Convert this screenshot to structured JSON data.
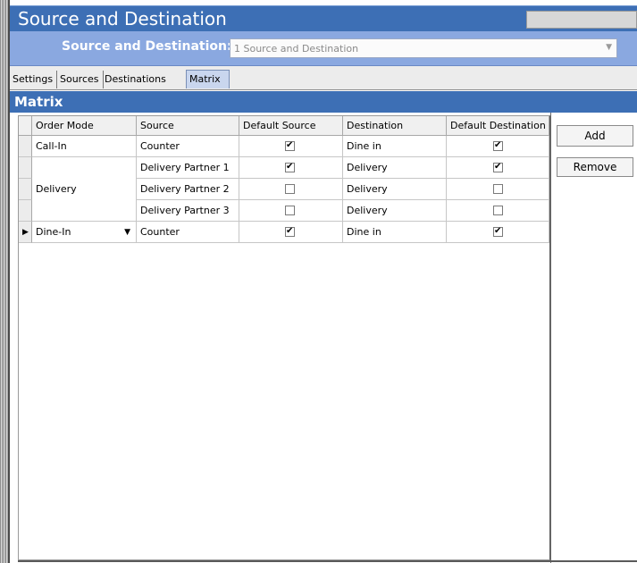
{
  "window": {
    "title": "Source and Destination"
  },
  "selector": {
    "label": "Source and Destination:",
    "value": "1 Source and Destination"
  },
  "tabs": [
    {
      "label": "Settings"
    },
    {
      "label": "Sources"
    },
    {
      "label": "Destinations"
    },
    {
      "label": "Matrix"
    }
  ],
  "active_tab": "Matrix",
  "section": {
    "title": "Matrix"
  },
  "grid": {
    "headers": [
      "Order Mode",
      "Source",
      "Default Source",
      "Destination",
      "Default Destination"
    ],
    "rows": [
      {
        "order_mode": "Call-In",
        "source": "Counter",
        "default_source": true,
        "destination": "Dine in",
        "default_destination": true
      },
      {
        "order_mode": "",
        "source": "Delivery Partner 1",
        "default_source": true,
        "destination": "Delivery",
        "default_destination": true
      },
      {
        "order_mode": "Delivery",
        "source": "Delivery Partner 2",
        "default_source": false,
        "destination": "Delivery",
        "default_destination": false
      },
      {
        "order_mode": "",
        "source": "Delivery Partner 3",
        "default_source": false,
        "destination": "Delivery",
        "default_destination": false
      },
      {
        "order_mode": "Dine-In",
        "source": "Counter",
        "default_source": true,
        "destination": "Dine in",
        "default_destination": true
      }
    ]
  },
  "buttons": {
    "add": "Add",
    "remove": "Remove"
  },
  "icons": {
    "row_selector": "current-row-arrow-icon",
    "dropdown": "chevron-down-icon",
    "check": "checkmark-icon"
  }
}
